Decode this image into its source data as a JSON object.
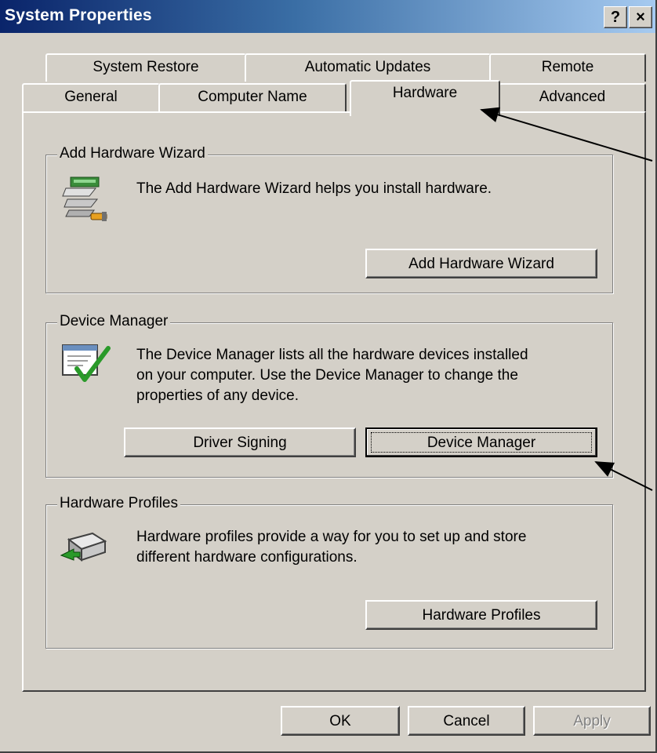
{
  "window": {
    "title": "System Properties",
    "help_label": "?",
    "close_label": "×"
  },
  "tabs": {
    "row_back": [
      "System Restore",
      "Automatic Updates",
      "Remote"
    ],
    "row_front": [
      "General",
      "Computer Name",
      "Hardware",
      "Advanced"
    ],
    "selected": "Hardware"
  },
  "groups": {
    "add_hardware": {
      "label": "Add Hardware Wizard",
      "description": "The Add Hardware Wizard helps you install hardware.",
      "button": "Add Hardware Wizard",
      "icon": "add-hardware-icon"
    },
    "device_manager": {
      "label": "Device Manager",
      "description_lines": [
        "The Device Manager lists all the hardware devices installed",
        "on your computer. Use the Device Manager to change the",
        "properties of any device."
      ],
      "driver_signing_button": "Driver Signing",
      "device_manager_button": "Device Manager",
      "icon": "device-manager-icon"
    },
    "hardware_profiles": {
      "label": "Hardware Profiles",
      "description_lines": [
        "Hardware profiles provide a way for you to set up and store",
        "different hardware configurations."
      ],
      "button": "Hardware Profiles",
      "icon": "hardware-profiles-icon"
    }
  },
  "footer": {
    "ok": "OK",
    "cancel": "Cancel",
    "apply": "Apply"
  }
}
